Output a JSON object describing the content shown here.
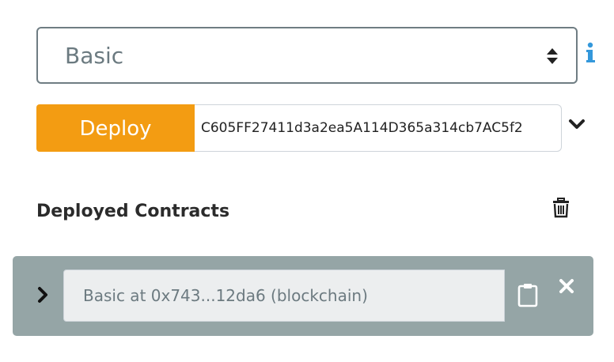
{
  "contract_select": {
    "value": "Basic",
    "arrows_icon": "sort-arrows-icon"
  },
  "info_icon": "info-icon",
  "deploy": {
    "button_label": "Deploy",
    "argument_value": "C605FF27411d3a2ea5A114D365a314cb7AC5f2",
    "chevron_icon": "chevron-down-icon"
  },
  "deployed": {
    "title": "Deployed Contracts",
    "trash_icon": "trash-icon",
    "contracts": [
      {
        "label": "Basic at 0x743...12da6 (blockchain)",
        "expand_icon": "chevron-right-icon",
        "copy_icon": "clipboard-icon",
        "remove_icon": "close-icon"
      }
    ]
  },
  "colors": {
    "deploy_button": "#f39c12",
    "info_icon": "#3498db",
    "contract_row_bg": "#95a5a6",
    "contract_name_bg": "#eceeef"
  }
}
